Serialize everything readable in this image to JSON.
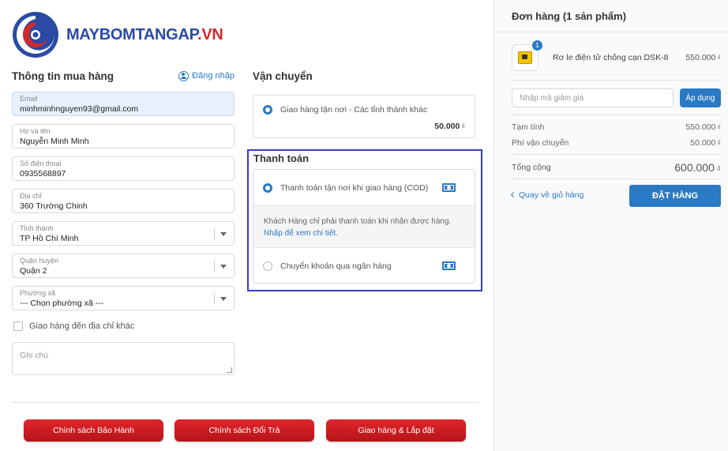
{
  "brand": {
    "logo_text_blue": "MAYBOMTANGAP",
    "logo_text_red": ".VN"
  },
  "buyer": {
    "title": "Thông tin mua hàng",
    "login_label": "Đăng nhập",
    "fields": [
      {
        "label": "Email",
        "value": "minhminhnguyen93@gmail.com"
      },
      {
        "label": "Họ và tên",
        "value": "Nguyễn Minh Minh"
      },
      {
        "label": "Số điện thoại",
        "value": "0935568897"
      },
      {
        "label": "Địa chỉ",
        "value": "360 Trường Chinh"
      },
      {
        "label": "Tỉnh thành",
        "value": "TP Hồ Chí Minh"
      },
      {
        "label": "Quận huyện",
        "value": "Quận 2"
      },
      {
        "label": "Phường xã",
        "value": "--- Chọn phường xã ---"
      }
    ],
    "other_address_label": "Giao hàng đến địa chỉ khác",
    "note_placeholder": "Ghi chú"
  },
  "shipping": {
    "title": "Vận chuyển",
    "option_label": "Giao hàng tận nơi - Các tỉnh thành khác",
    "price": "50.000",
    "currency": "₫"
  },
  "payment": {
    "title": "Thanh toán",
    "options": [
      {
        "label": "Thanh toán tận nơi khi giao hàng (COD)",
        "selected": true,
        "icon": "cash-icon"
      },
      {
        "label": "Chuyển khoản qua ngân hàng",
        "selected": false,
        "icon": "cash-icon"
      }
    ],
    "note_text": "Khách Hàng chỉ phải thanh toán khi nhận được hàng.",
    "note_link": "Nhấp để xem chi tiết."
  },
  "footer_buttons": [
    "Chính sách Bảo Hành",
    "Chính sách Đổi Trả",
    "Giao hàng & Lắp đặt"
  ],
  "order": {
    "title": "Đơn hàng (1 sản phẩm)",
    "product": {
      "name": "Rơ le điện tử chống cạn DSK-8",
      "price": "550.000",
      "qty": "1"
    },
    "currency": "₫",
    "coupon_placeholder": "Nhập mã giảm giá",
    "apply_label": "Áp dụng",
    "subtotal_label": "Tạm tính",
    "subtotal": "550.000",
    "shipping_label": "Phí vận chuyển",
    "shipping": "50.000",
    "total_label": "Tổng cộng",
    "total": "600.000",
    "back_label": "Quay về giỏ hàng",
    "submit_label": "ĐẶT HÀNG"
  },
  "colors": {
    "accent": "#2a79c4",
    "brand_blue": "#2a4aa5",
    "brand_red": "#d12a2a",
    "highlight": "#3a3dbf"
  }
}
